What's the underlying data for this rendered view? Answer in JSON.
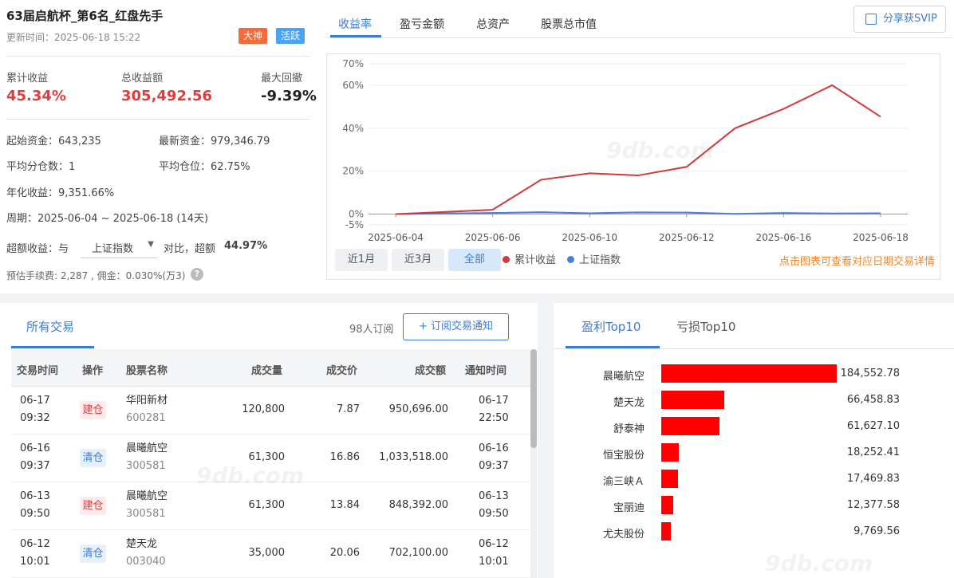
{
  "header": {
    "title": "63届启航杯_第6名_红盘先手",
    "update_time": "更新时间：2025-06-18 15:22",
    "badge_master": "大神",
    "badge_active": "活跃"
  },
  "stats": {
    "cum_return_label": "累计收益",
    "cum_return_value": "45.34%",
    "total_profit_label": "总收益额",
    "total_profit_value": "305,492.56",
    "max_drawdown_label": "最大回撤",
    "max_drawdown_value": "-9.39%"
  },
  "details": {
    "start_capital": "起始资金：643,235",
    "latest_capital": "最新资金：979,346.79",
    "avg_split": "平均分仓数：1",
    "avg_position": "平均仓位：62.75%",
    "annual_return": "年化收益：9,351.66%",
    "period": "周期：2025-06-04 ~ 2025-06-18 (14天)",
    "excess_prefix": "超额收益：与",
    "benchmark": "上证指数",
    "excess_mid": "对比，超额",
    "excess_value": "44.97%",
    "fee": "预估手续费: 2,287 , 佣金：0.030%(万3)",
    "help": "?"
  },
  "tabs": [
    "收益率",
    "盈亏金额",
    "总资产",
    "股票总市值"
  ],
  "share_button": "分享获SVIP",
  "range_buttons": [
    "近1月",
    "近3月",
    "全部"
  ],
  "chart_hint": "点击图表可查看对应日期交易详情",
  "watermark": "9db.com",
  "chart_data": {
    "type": "line",
    "x": [
      "2025-06-04",
      "2025-06-05",
      "2025-06-06",
      "2025-06-09",
      "2025-06-10",
      "2025-06-11",
      "2025-06-12",
      "2025-06-13",
      "2025-06-16",
      "2025-06-17",
      "2025-06-18"
    ],
    "x_tick_labels": [
      "2025-06-04",
      "2025-06-06",
      "2025-06-10",
      "2025-06-12",
      "2025-06-16",
      "2025-06-18"
    ],
    "series": [
      {
        "name": "累计收益",
        "color": "#d0393d",
        "values": [
          0,
          1,
          2,
          16,
          19,
          18,
          22,
          40,
          49,
          60,
          45.34
        ]
      },
      {
        "name": "上证指数",
        "color": "#4a7fd8",
        "values": [
          0,
          0.3,
          0.5,
          0.9,
          0.4,
          0.8,
          0.7,
          0.1,
          0.5,
          0.3,
          0.37
        ]
      }
    ],
    "y_ticks": [
      "70%",
      "60%",
      "40%",
      "20%",
      "0%",
      "-5%"
    ],
    "ylim": [
      -5,
      70
    ],
    "legend": "bottom-left"
  },
  "trades": {
    "tab": "所有交易",
    "subscribers": "98人订阅",
    "subscribe_button": "+ 订阅交易通知",
    "columns": [
      "交易时间",
      "操作",
      "股票名称",
      "成交量",
      "成交价",
      "成交额",
      "通知时间"
    ],
    "rows": [
      {
        "date": "06-17",
        "time": "09:32",
        "op": "建仓",
        "type": "build",
        "name": "华阳新材",
        "code": "600281",
        "vol": "120,800",
        "price": "7.87",
        "amount": "950,696.00",
        "ndate": "06-17",
        "ntime": "22:50"
      },
      {
        "date": "06-16",
        "time": "09:37",
        "op": "清仓",
        "type": "clear",
        "name": "晨曦航空",
        "code": "300581",
        "vol": "61,300",
        "price": "16.86",
        "amount": "1,033,518.00",
        "ndate": "06-16",
        "ntime": "09:37"
      },
      {
        "date": "06-13",
        "time": "09:50",
        "op": "建仓",
        "type": "build",
        "name": "晨曦航空",
        "code": "300581",
        "vol": "61,300",
        "price": "13.84",
        "amount": "848,392.00",
        "ndate": "06-13",
        "ntime": "09:50"
      },
      {
        "date": "06-12",
        "time": "10:01",
        "op": "清仓",
        "type": "clear",
        "name": "楚天龙",
        "code": "003040",
        "vol": "35,000",
        "price": "20.06",
        "amount": "702,100.00",
        "ndate": "06-12",
        "ntime": "10:01"
      }
    ]
  },
  "top10": {
    "tab_profit": "盈利Top10",
    "tab_loss": "亏损Top10",
    "items": [
      {
        "name": "晨曦航空",
        "value": 184552.78,
        "label": "184,552.78"
      },
      {
        "name": "楚天龙",
        "value": 66458.83,
        "label": "66,458.83"
      },
      {
        "name": "舒泰神",
        "value": 61627.1,
        "label": "61,627.10"
      },
      {
        "name": "恒宝股份",
        "value": 18252.41,
        "label": "18,252.41"
      },
      {
        "name": "渝三峡Ａ",
        "value": 17469.83,
        "label": "17,469.83"
      },
      {
        "name": "宝丽迪",
        "value": 12377.58,
        "label": "12,377.58"
      },
      {
        "name": "尤夫股份",
        "value": 9769.56,
        "label": "9,769.56"
      }
    ]
  }
}
